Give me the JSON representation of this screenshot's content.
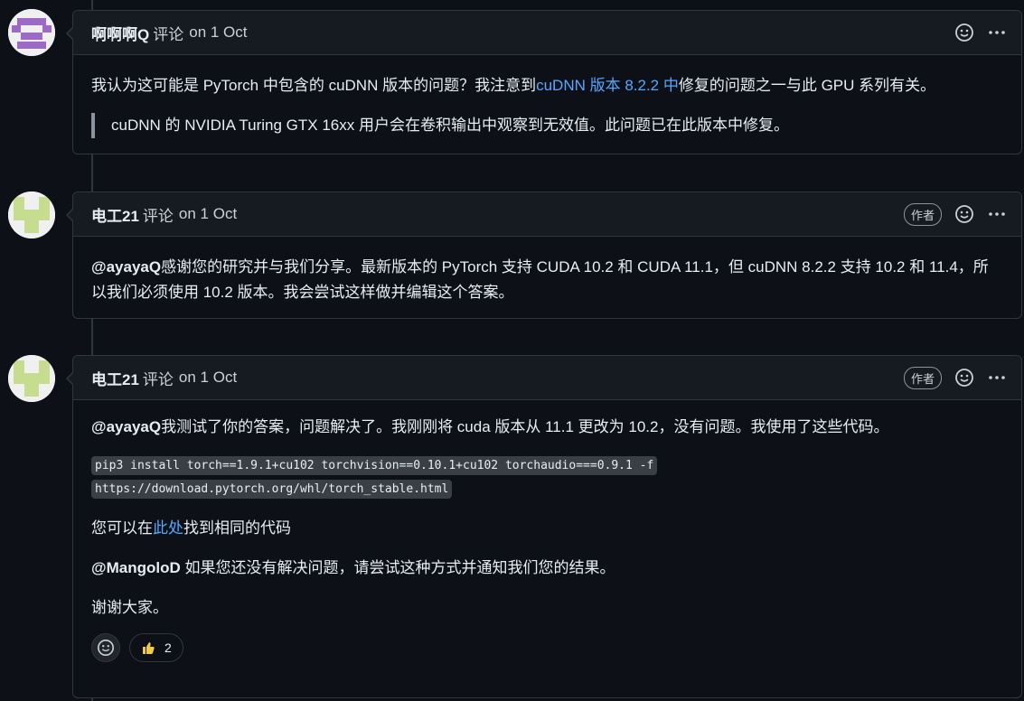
{
  "comments": [
    {
      "author": "啊啊啊Q",
      "action": "评论",
      "date": "on 1 Oct",
      "body": {
        "p1_text": "我认为这可能是 PyTorch 中包含的 cuDNN 版本的问题？我注意到",
        "p1_link": "cuDNN 版本 8.2.2 中",
        "p1_rest": "修复的问题之一与此 GPU 系列有关。",
        "quote": "cuDNN 的 NVIDIA Turing GTX 16xx 用户会在卷积输出中观察到无效值。此问题已在此版本中修复。"
      }
    },
    {
      "author": "电工21",
      "action": "评论",
      "date": "on 1 Oct",
      "badge": "作者",
      "body": {
        "mention": "@ayayaQ",
        "text": "感谢您的研究并与我们分享。最新版本的 PyTorch 支持 CUDA 10.2 和 CUDA 11.1，但 cuDNN 8.2.2 支持 10.2 和 11.4，所以我们必须使用 10.2 版本。我会尝试这样做并编辑这个答案。"
      }
    },
    {
      "author": "电工21",
      "action": "评论",
      "date": "on 1 Oct",
      "badge": "作者",
      "body": {
        "p1_mention": "@ayayaQ",
        "p1_text": "我测试了你的答案，问题解决了。我刚刚将 cuda 版本从 11.1 更改为 10.2，没有问题。我使用了这些代码。",
        "code_line1": "pip3 install torch==1.9.1+cu102 torchvision==0.10.1+cu102 torchaudio===0.9.1 -f",
        "code_line2": "https://download.pytorch.org/whl/torch_stable.html",
        "p3_text": "您可以在",
        "p3_link": "此处",
        "p3_rest": "找到相同的代码",
        "p4_mention": "@MangoloD",
        "p4_text": " 如果您还没有解决问题，请尝试这种方式并通知我们您的结果。",
        "p5_text": "谢谢大家。"
      },
      "reactions": {
        "thumbs_up_count": "2"
      }
    }
  ],
  "icons": {
    "emoji": "smiley-icon",
    "menu": "kebab-menu-icon",
    "thumbs": "thumbs-up-icon"
  },
  "colors": {
    "background": "#0d1117",
    "header": "#161b22",
    "border": "#30363d",
    "link": "#58a6ff"
  }
}
